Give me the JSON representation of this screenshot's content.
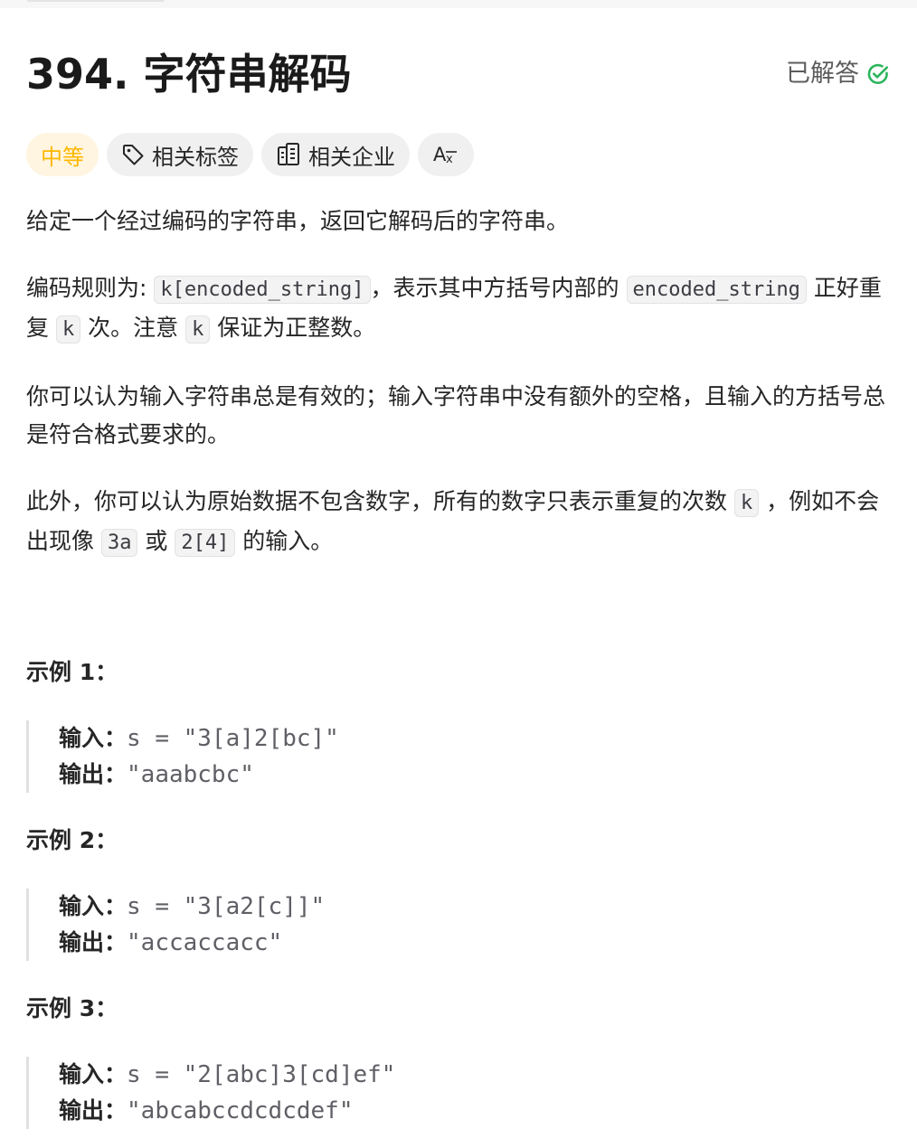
{
  "problem": {
    "title": "394. 字符串解码",
    "status": "已解答",
    "status_color": "#2db55d"
  },
  "tags": {
    "difficulty": "中等",
    "difficulty_color": "#ffb800",
    "related_tags": "相关标签",
    "related_companies": "相关企业",
    "translate_icon_text": "Aᵪ"
  },
  "description": {
    "p1": "给定一个经过编码的字符串，返回它解码后的字符串。",
    "p2_a": "编码规则为: ",
    "p2_code1": "k[encoded_string]",
    "p2_b": "，表示其中方括号内部的 ",
    "p2_code2": "encoded_string",
    "p2_c": " 正好重复 ",
    "p2_code3": "k",
    "p2_d": " 次。注意 ",
    "p2_code4": "k",
    "p2_e": " 保证为正整数。",
    "p3": "你可以认为输入字符串总是有效的；输入字符串中没有额外的空格，且输入的方括号总是符合格式要求的。",
    "p4_a": "此外，你可以认为原始数据不包含数字，所有的数字只表示重复的次数 ",
    "p4_code1": "k",
    "p4_b": " ，例如不会出现像 ",
    "p4_code2": "3a",
    "p4_c": " 或 ",
    "p4_code3": "2[4]",
    "p4_d": " 的输入。"
  },
  "examples": [
    {
      "title": "示例 1：",
      "input_label": "输入：",
      "input_value": "s = \"3[a]2[bc]\"",
      "output_label": "输出：",
      "output_value": "\"aaabcbc\""
    },
    {
      "title": "示例 2：",
      "input_label": "输入：",
      "input_value": "s = \"3[a2[c]]\"",
      "output_label": "输出：",
      "output_value": "\"accaccacc\""
    },
    {
      "title": "示例 3：",
      "input_label": "输入：",
      "input_value": "s = \"2[abc]3[cd]ef\"",
      "output_label": "输出：",
      "output_value": "\"abcabccdcdcdef\""
    }
  ]
}
